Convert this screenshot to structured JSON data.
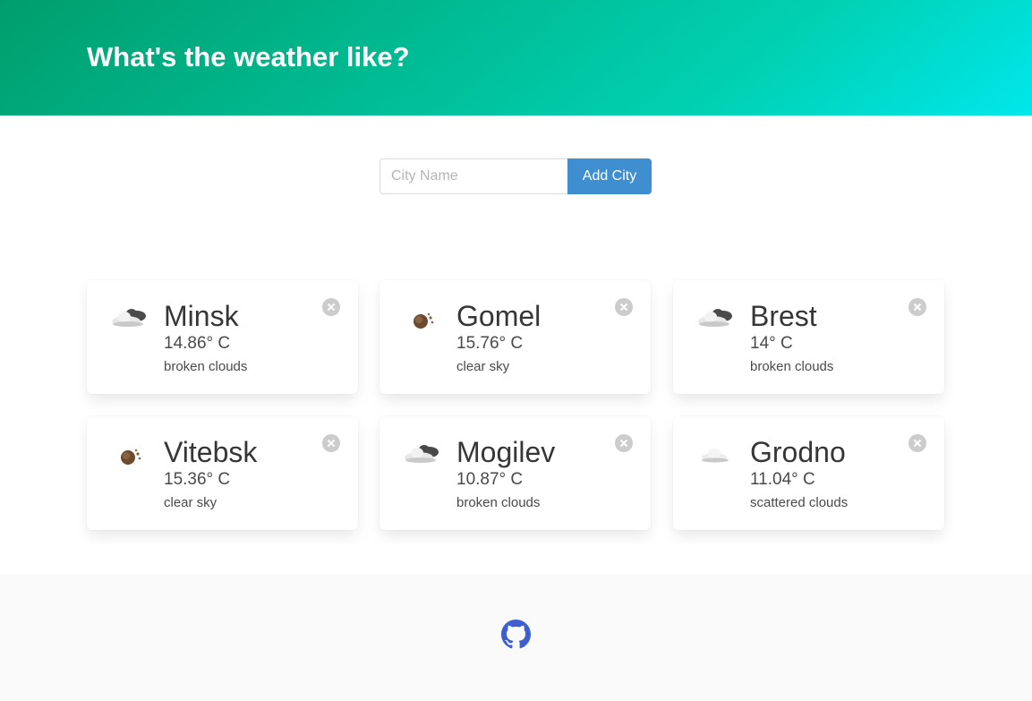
{
  "header": {
    "title": "What's the weather like?"
  },
  "search": {
    "placeholder": "City Name",
    "value": "",
    "button_label": "Add City"
  },
  "cities": [
    {
      "name": "Minsk",
      "temp": "14.86° C",
      "desc": "broken clouds",
      "icon": "broken-clouds-icon"
    },
    {
      "name": "Gomel",
      "temp": "15.76° C",
      "desc": "clear sky",
      "icon": "clear-sky-icon"
    },
    {
      "name": "Brest",
      "temp": "14° C",
      "desc": "broken clouds",
      "icon": "broken-clouds-icon"
    },
    {
      "name": "Vitebsk",
      "temp": "15.36° C",
      "desc": "clear sky",
      "icon": "clear-sky-icon"
    },
    {
      "name": "Mogilev",
      "temp": "10.87° C",
      "desc": "broken clouds",
      "icon": "broken-clouds-icon"
    },
    {
      "name": "Grodno",
      "temp": "11.04° C",
      "desc": "scattered clouds",
      "icon": "scattered-clouds-icon"
    }
  ],
  "footer": {
    "icon": "github-icon"
  },
  "colors": {
    "accent": "#3e8ed0",
    "hero_start": "#009e6c",
    "hero_end": "#00e7eb",
    "github": "#3e5fcf"
  }
}
